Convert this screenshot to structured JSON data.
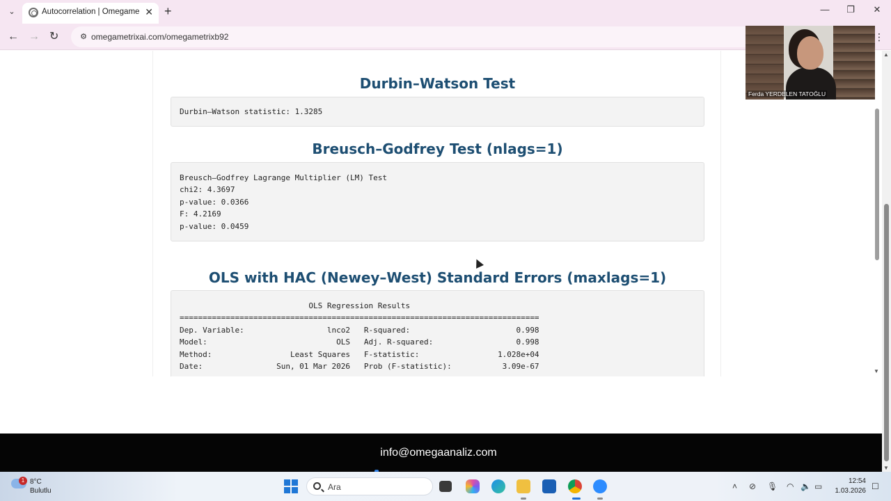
{
  "browser": {
    "tab_title": "Autocorrelation | OmegametriX",
    "url": "omegametrixai.com/omegametrixb92"
  },
  "video": {
    "participant_name": "Ferda YERDELEN TATOĞLU"
  },
  "sections": {
    "dw_title": "Durbin–Watson Test",
    "dw_line": "Durbin–Watson statistic: 1.3285",
    "bg_title": "Breusch–Godfrey Test (nlags=1)",
    "bg_lines": [
      "Breusch–Godfrey Lagrange Multiplier (LM) Test",
      "chi2: 4.3697",
      "p-value: 0.0366",
      "F: 4.2169",
      "p-value: 0.0459"
    ],
    "ols_title": "OLS with HAC (Newey–West) Standard Errors (maxlags=1)",
    "ols_lines": [
      "                            OLS Regression Results                            ",
      "==============================================================================",
      "Dep. Variable:                  lnco2   R-squared:                       0.998",
      "Model:                            OLS   Adj. R-squared:                  0.998",
      "Method:                 Least Squares   F-statistic:                 1.028e+04",
      "Date:                Sun, 01 Mar 2026   Prob (F-statistic):           3.09e-67"
    ]
  },
  "footer": {
    "email": "info@omegaanaliz.com"
  },
  "taskbar": {
    "weather_badge": "1",
    "weather_temp": "8°C",
    "weather_desc": "Bulutlu",
    "search_placeholder": "Ara",
    "clock_time": "12:54",
    "clock_date": "1.03.2026"
  }
}
